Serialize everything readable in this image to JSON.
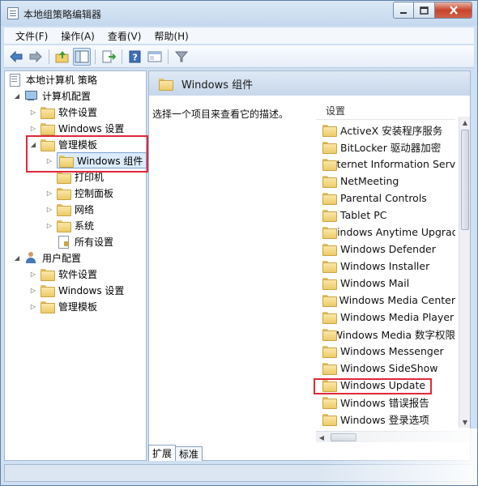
{
  "window": {
    "title": "本地组策略编辑器"
  },
  "menu": [
    "文件(F)",
    "操作(A)",
    "查看(V)",
    "帮助(H)"
  ],
  "tree": {
    "root": "本地计算机 策略",
    "computer_config": "计算机配置",
    "software_settings": "软件设置",
    "windows_settings": "Windows 设置",
    "admin_templates": "管理模板",
    "windows_components": "Windows 组件",
    "printers": "打印机",
    "control_panel": "控制面板",
    "network": "网络",
    "system": "系统",
    "all_settings": "所有设置",
    "user_config": "用户配置",
    "user_software_settings": "软件设置",
    "user_windows_settings": "Windows 设置",
    "user_admin_templates": "管理模板"
  },
  "right": {
    "header": "Windows 组件",
    "description": "选择一个项目来查看它的描述。",
    "list_header": "设置",
    "items": [
      "ActiveX 安装程序服务",
      "BitLocker 驱动器加密",
      "Internet Information Serv",
      "NetMeeting",
      "Parental Controls",
      "Tablet PC",
      "Windows Anytime Upgrad",
      "Windows Defender",
      "Windows Installer",
      "Windows Mail",
      "Windows Media Center",
      "Windows Media Player",
      "Windows Media 数字权限",
      "Windows Messenger",
      "Windows SideShow",
      "Windows Update",
      "Windows 错误报告",
      "Windows 登录选项"
    ]
  },
  "tabs": [
    "扩展",
    "标准"
  ],
  "colors": {
    "highlight": "#e0283a",
    "selection": "#dcebfc"
  }
}
